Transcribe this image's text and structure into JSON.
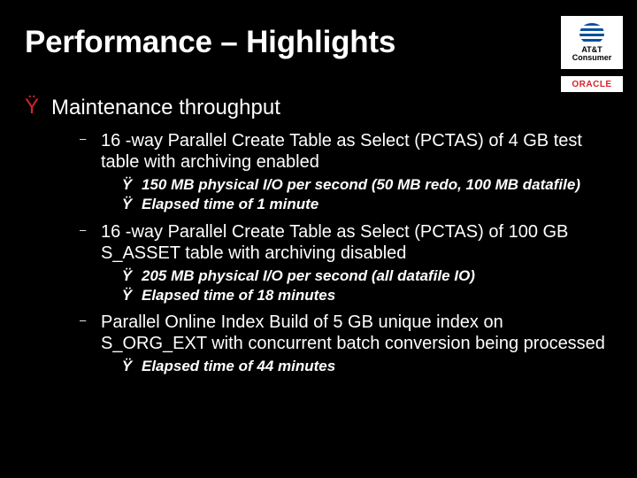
{
  "logos": {
    "att_line": "AT&T Consumer",
    "oracle": "ORACLE"
  },
  "title": "Performance – Highlights",
  "bullets": {
    "y": "Ÿ",
    "dash": "–",
    "l1_1": "Maintenance throughput",
    "l2_1": "16 -way Parallel Create Table as Select (PCTAS) of 4 GB test table with archiving enabled",
    "l3_1": "150 MB physical I/O per second (50 MB redo, 100 MB datafile)",
    "l3_2": "Elapsed time of 1 minute",
    "l2_2": "16 -way Parallel Create Table as Select (PCTAS) of 100 GB S_ASSET table with archiving disabled",
    "l3_3": "205 MB physical I/O per second (all datafile IO)",
    "l3_4": "Elapsed time of 18 minutes",
    "l2_3": "Parallel Online Index Build of 5 GB unique index on S_ORG_EXT with concurrent batch conversion being processed",
    "l3_5": "Elapsed time of 44 minutes"
  }
}
